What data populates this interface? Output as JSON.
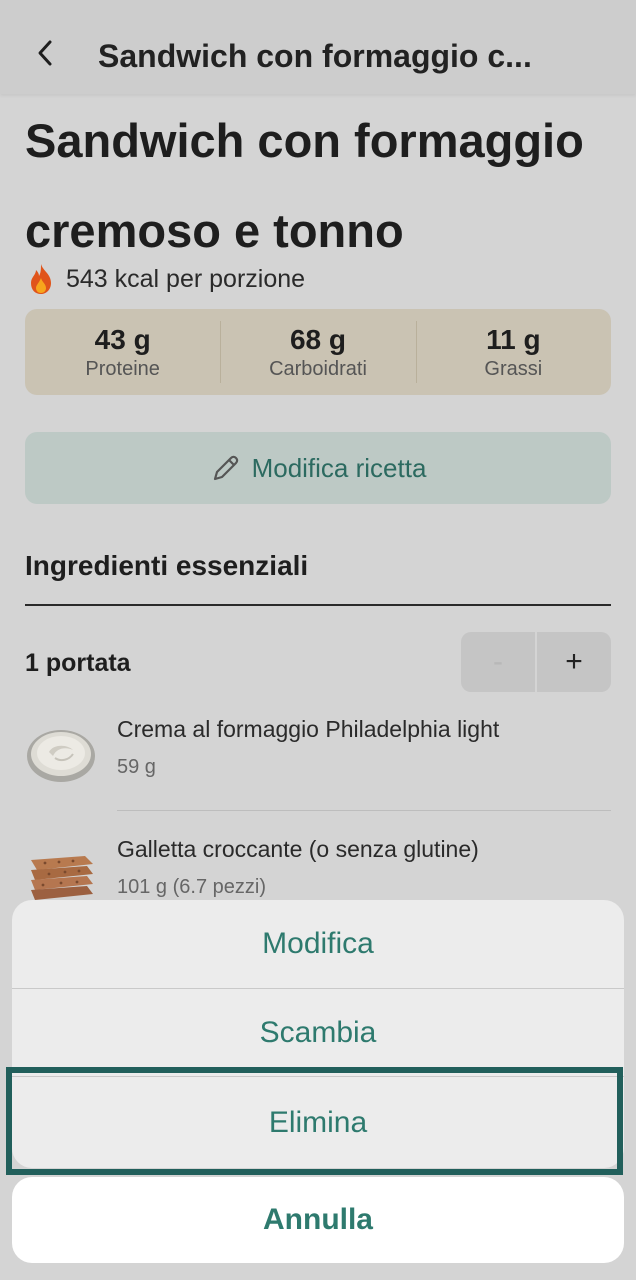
{
  "nav": {
    "title": "Sandwich con formaggio c..."
  },
  "recipe": {
    "title_line1": "Sandwich con formaggio",
    "title_line2": "cremoso e tonno",
    "kcal": "543 kcal per porzione"
  },
  "macros": [
    {
      "value": "43 g",
      "label": "Proteine"
    },
    {
      "value": "68 g",
      "label": "Carboidrati"
    },
    {
      "value": "11 g",
      "label": "Grassi"
    }
  ],
  "edit_button": {
    "label": "Modifica ricetta"
  },
  "ingredients_section": {
    "title": "Ingredienti essenziali"
  },
  "servings": {
    "label": "1 portata",
    "minus": "-",
    "plus": "+"
  },
  "ingredients": [
    {
      "name": "Crema al formaggio Philadelphia light",
      "qty": "59 g"
    },
    {
      "name": "Galletta croccante (o senza glutine)",
      "qty": "101 g (6.7 pezzi)"
    }
  ],
  "action_sheet": {
    "options": [
      "Modifica",
      "Scambia",
      "Elimina"
    ],
    "cancel": "Annulla"
  },
  "colors": {
    "accent": "#2e7a6e",
    "highlight": "#215f5b",
    "macro_bg": "#cac3b3"
  }
}
